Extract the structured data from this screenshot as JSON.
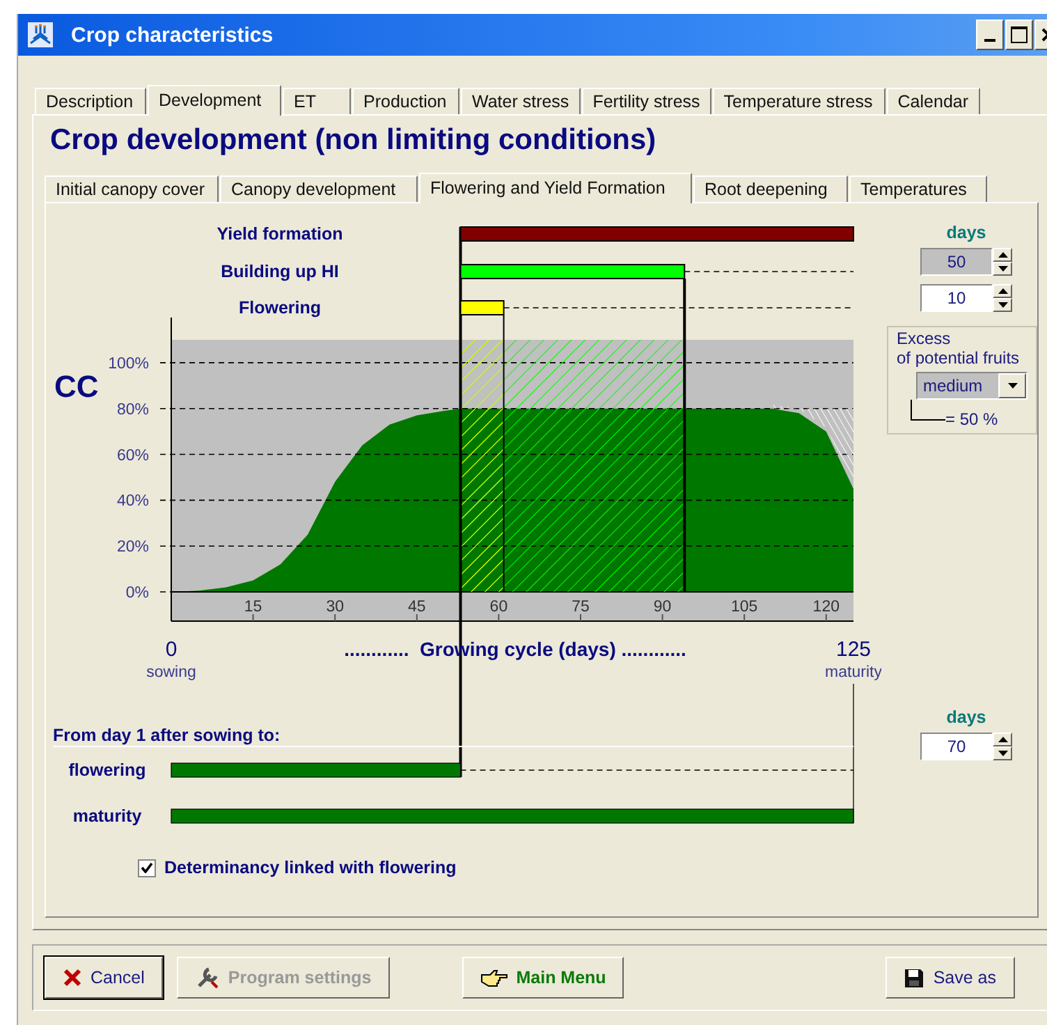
{
  "window": {
    "title": "Crop characteristics"
  },
  "tabs": [
    {
      "label": "Description",
      "selected": false
    },
    {
      "label": "Development",
      "selected": true
    },
    {
      "label": "ET",
      "selected": false
    },
    {
      "label": "Production",
      "selected": false
    },
    {
      "label": "Water stress",
      "selected": false
    },
    {
      "label": "Fertility stress",
      "selected": false
    },
    {
      "label": "Temperature stress",
      "selected": false
    },
    {
      "label": "Calendar",
      "selected": false
    }
  ],
  "heading": "Crop development (non limiting conditions)",
  "subtabs": [
    {
      "label": "Initial canopy cover",
      "selected": false
    },
    {
      "label": "Canopy development",
      "selected": false
    },
    {
      "label": "Flowering and Yield Formation",
      "selected": true
    },
    {
      "label": "Root deepening",
      "selected": false
    },
    {
      "label": "Temperatures",
      "selected": false
    }
  ],
  "phases": [
    {
      "label": "Yield formation",
      "color": "#800000",
      "level": 1
    },
    {
      "label": "Building up HI",
      "color": "#00ff00",
      "level": 0.57
    },
    {
      "label": "Flowering",
      "color": "#ffff00",
      "level": 0.11
    }
  ],
  "chart_data": {
    "type": "area",
    "ylabel": "CC",
    "xlabel": "............  Growing cycle (days) ............",
    "grid": true,
    "x": [
      0,
      5,
      10,
      15,
      20,
      25,
      30,
      35,
      40,
      45,
      50,
      53,
      100,
      110,
      115,
      120,
      125
    ],
    "series": [
      {
        "color": "#007800",
        "values": [
          0,
          0.5,
          2,
          5,
          12,
          25,
          48,
          64,
          73,
          77,
          79,
          80,
          80,
          80,
          78,
          70,
          45
        ]
      }
    ],
    "xlim": [
      0,
      125
    ],
    "ylim": [
      0,
      110
    ],
    "xticks": [
      15,
      30,
      45,
      60,
      75,
      90,
      105,
      120
    ],
    "yticks": [
      {
        "value": 0,
        "label": "0%"
      },
      {
        "value": 20,
        "label": "20%"
      },
      {
        "value": 40,
        "label": "40%"
      },
      {
        "value": 60,
        "label": "60%"
      },
      {
        "value": 80,
        "label": "80%"
      },
      {
        "value": 100,
        "label": "100%"
      }
    ]
  },
  "axis_ends": [
    {
      "value": "0",
      "caption": "sowing"
    },
    {
      "value": "125",
      "caption": "maturity"
    }
  ],
  "days_label": "days",
  "spinners": [
    {
      "value": "50",
      "disabled": true
    },
    {
      "value": "10",
      "disabled": false
    }
  ],
  "excess": {
    "title": "Excess",
    "subtitle": "of potential fruits",
    "choice": "medium",
    "note": "= 50 %"
  },
  "lengths": {
    "title": "From day 1 after sowing to:",
    "days_label": "days",
    "value": "70",
    "rows": [
      {
        "label": "flowering",
        "level": 0.424
      },
      {
        "label": "maturity",
        "level": 1
      }
    ]
  },
  "determinancy": {
    "label": "Determinancy linked with flowering",
    "checked": true
  },
  "buttons": [
    {
      "kind": "cancel",
      "label": "Cancel",
      "disabled": false
    },
    {
      "kind": "settings",
      "label": "Program settings",
      "disabled": true
    },
    {
      "kind": "menu",
      "label": "Main Menu",
      "disabled": false
    },
    {
      "kind": "save",
      "label": "Save as",
      "disabled": false
    }
  ]
}
